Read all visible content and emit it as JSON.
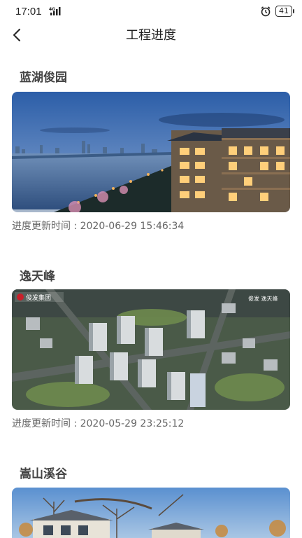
{
  "status_bar": {
    "time": "17:01",
    "network": "4G",
    "battery": "41",
    "alarm_icon": "alarm-icon"
  },
  "nav": {
    "back_icon": "back-arrow-icon",
    "title": "工程进度"
  },
  "projects": [
    {
      "name": "蓝湖俊园",
      "image": "lakeside-residential-dusk-rendering",
      "update_time": "进度更新时间 : 2020-06-29 15:46:34"
    },
    {
      "name": "逸天峰",
      "image": "aerial-residential-complex-rendering",
      "update_time": "进度更新时间 : 2020-05-29 23:25:12",
      "watermark_brand": "俊发集团",
      "watermark_project": "俊发 逸天峰"
    },
    {
      "name": "嵩山溪谷",
      "image": "villa-garden-rendering"
    }
  ]
}
